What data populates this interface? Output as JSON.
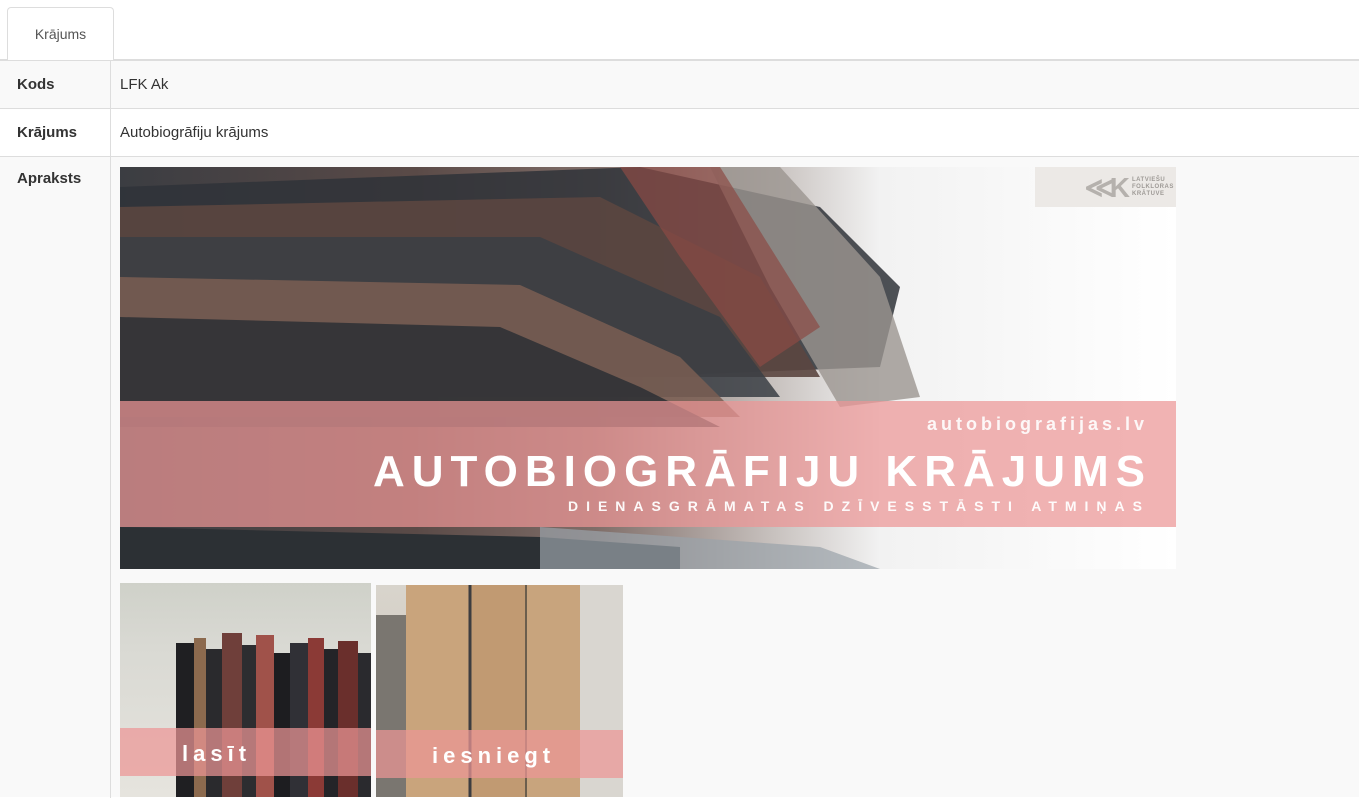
{
  "tabs": [
    {
      "label": "Krājums",
      "active": true
    }
  ],
  "rows": {
    "code": {
      "label": "Kods",
      "value": "LFK Ak"
    },
    "collection": {
      "label": "Krājums",
      "value": "Autobiogrāfiju krājums"
    },
    "description": {
      "label": "Apraksts"
    }
  },
  "banner": {
    "site": "autobiografijas.lv",
    "title": "AUTOBIOGRĀFIJU KRĀJUMS",
    "subtitle": "DIENASGRĀMATAS  DZĪVESSTĀSTI  ATMIŅAS",
    "logo_mark": "≪K",
    "logo_text": "LATVIEŠU FOLKLORAS KRĀTUVE"
  },
  "thumbs": {
    "read": {
      "label": "lasīt"
    },
    "submit": {
      "label": "iesniegt"
    }
  },
  "colors": {
    "accent_pink": "#ec9696",
    "border": "#dddddd",
    "stripe": "#f9f9f9"
  }
}
